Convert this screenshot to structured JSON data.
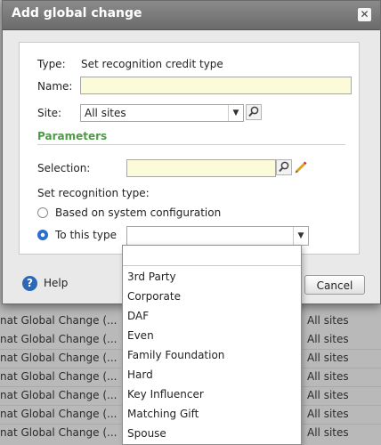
{
  "background": {
    "rows": [
      {
        "name": "nat Global Change (...",
        "site": "All sites"
      },
      {
        "name": "nat Global Change (...",
        "site": "All sites"
      },
      {
        "name": "nat Global Change (...",
        "site": "All sites"
      },
      {
        "name": "nat Global Change (...",
        "site": "All sites"
      },
      {
        "name": "nat Global Change (...",
        "site": "All sites"
      },
      {
        "name": "nat Global Change (...",
        "site": "All sites"
      },
      {
        "name": "nat Global Change (...",
        "site": "All sites"
      }
    ]
  },
  "dialog": {
    "title": "Add global change",
    "close_icon": "close-icon",
    "type_label": "Type:",
    "type_value": "Set recognition credit type",
    "name_label": "Name:",
    "name_value": "",
    "site_label": "Site:",
    "site_value": "All sites",
    "parameters_title": "Parameters",
    "selection_label": "Selection:",
    "selection_value": "",
    "recognition_label": "Set recognition type:",
    "radio_system": "Based on system configuration",
    "radio_this_type": "To this type",
    "this_type_value": "",
    "help_label": "Help",
    "cancel_label": "Cancel"
  },
  "dropdown": {
    "options": [
      "",
      "3rd Party",
      "Corporate",
      "DAF",
      "Even",
      "Family Foundation",
      "Hard",
      "Key Influencer",
      "Matching Gift",
      "Spouse"
    ]
  },
  "colors": {
    "accent_green": "#4e9a47",
    "radio_blue": "#2a6fcb",
    "field_yellow": "#fbfbd9"
  }
}
